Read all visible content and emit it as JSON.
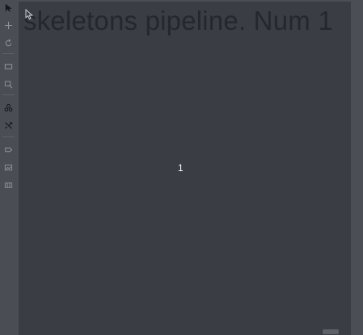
{
  "canvas": {
    "title": "skeletons pipeline. Num 1",
    "center_label": "1"
  },
  "toolbar": {
    "tools": [
      {
        "name": "select-arrow-icon"
      },
      {
        "name": "move-icon"
      },
      {
        "name": "rotate-icon"
      },
      {
        "name": "rectangle-icon"
      },
      {
        "name": "area-select-icon"
      },
      {
        "name": "group-icon"
      },
      {
        "name": "split-icon"
      },
      {
        "name": "tag-icon"
      },
      {
        "name": "image-icon"
      },
      {
        "name": "grid-icon"
      }
    ]
  },
  "colors": {
    "canvas_bg": "#3a3d44",
    "panel_bg": "#4b4e55",
    "title_text": "#24272c",
    "label_text": "#ffffff"
  }
}
